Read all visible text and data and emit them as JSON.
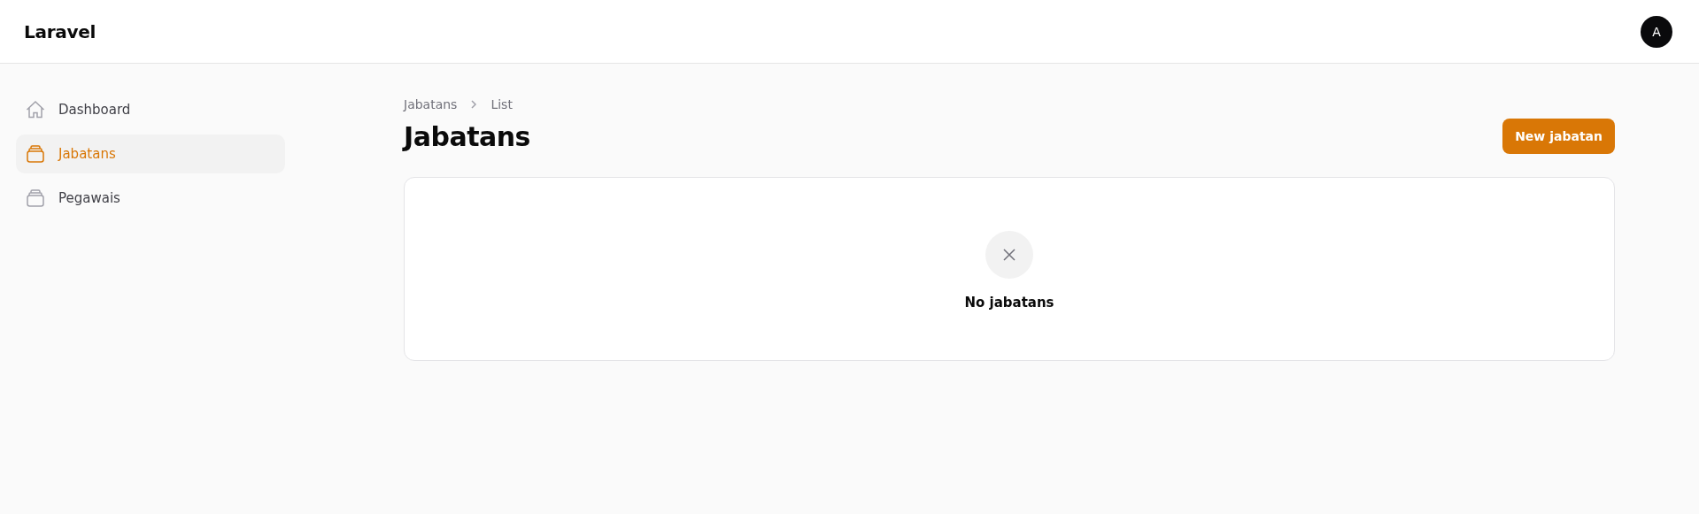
{
  "header": {
    "brand": "Laravel",
    "avatar": "A"
  },
  "sidebar": {
    "items": [
      {
        "label": "Dashboard",
        "kind": "home",
        "selected": false
      },
      {
        "label": "Jabatans",
        "kind": "stack",
        "selected": true
      },
      {
        "label": "Pegawais",
        "kind": "stack",
        "selected": false
      }
    ]
  },
  "breadcrumbs": [
    "Jabatans",
    "List"
  ],
  "page_title": "Jabatans",
  "primary_button": "New jabatan",
  "empty_state": {
    "heading": "No jabatans"
  }
}
